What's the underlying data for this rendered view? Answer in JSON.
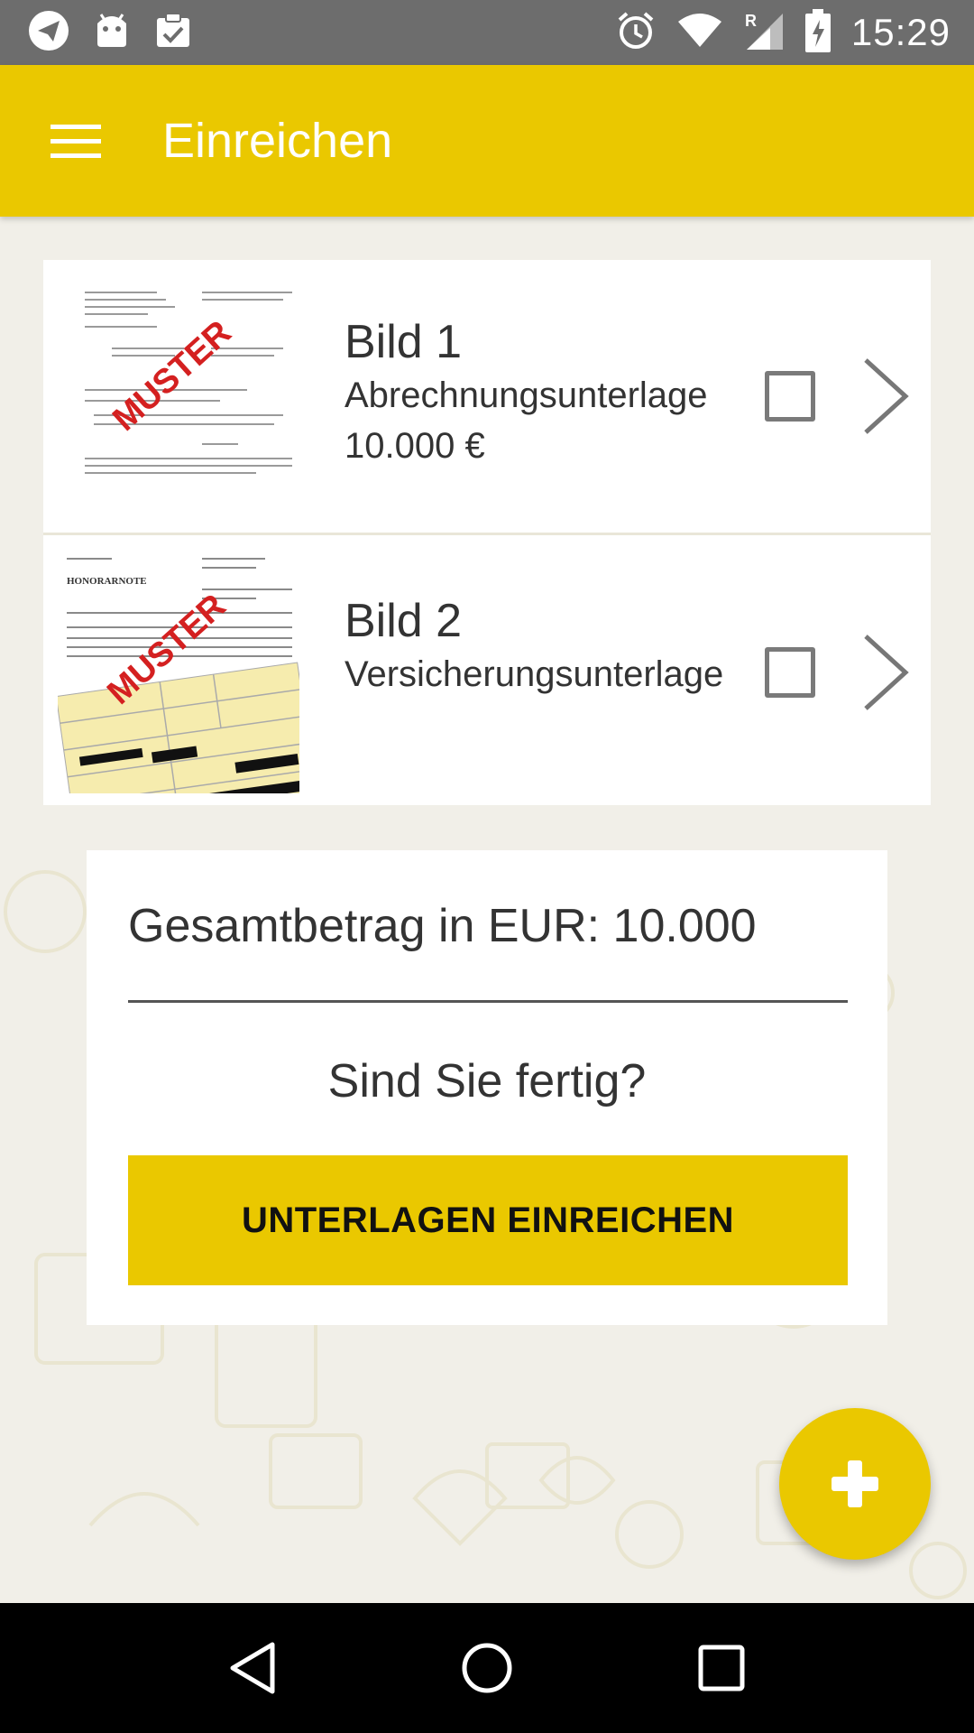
{
  "status_bar": {
    "time": "15:29",
    "icons": [
      "telegram-icon",
      "android-icon",
      "clipboard-check-icon",
      "alarm-icon",
      "wifi-icon",
      "signal-roaming-icon",
      "battery-charging-icon"
    ]
  },
  "app_bar": {
    "title": "Einreichen",
    "menu_icon": "hamburger-menu-icon"
  },
  "documents": [
    {
      "title": "Bild 1",
      "type": "Abrechnungsunterlage",
      "amount": "10.000 €",
      "thumbnail_stamp": "MUSTER",
      "checked": false
    },
    {
      "title": "Bild 2",
      "type": "Versicherungsunterlage",
      "thumbnail_stamp": "MUSTER",
      "thumbnail_heading": "HONORARNOTE",
      "checked": false
    }
  ],
  "summary": {
    "total_label": "Gesamtbetrag in EUR: 10.000",
    "question": "Sind Sie fertig?",
    "submit_label": "UNTERLAGEN EINREICHEN"
  },
  "fab": {
    "icon": "plus-icon"
  },
  "nav_bar": {
    "icons": [
      "back-icon",
      "home-icon",
      "recents-icon"
    ]
  },
  "colors": {
    "primary": "#eac800",
    "background": "#f1efe8",
    "status_bar": "#6d6d6d",
    "nav_bar": "#000000"
  }
}
